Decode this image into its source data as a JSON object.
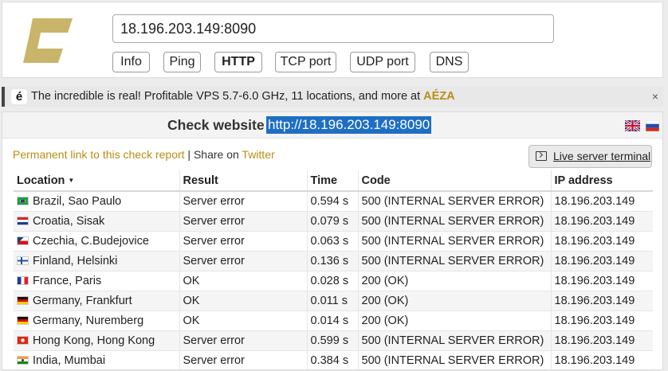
{
  "header": {
    "url_value": "18.196.203.149:8090",
    "tabs": [
      "Info",
      "Ping",
      "HTTP",
      "TCP port",
      "UDP port",
      "DNS"
    ],
    "active_tab": "HTTP"
  },
  "ad": {
    "badge": "é",
    "text": "The incredible is real! Profitable VPS 5.7-6.0 GHz, 11 locations, and more at ",
    "brand": "AÉZA",
    "close": "×"
  },
  "panel": {
    "title": "Check website",
    "url": "http://18.196.203.149:8090",
    "permalink": "Permanent link to this check report",
    "separator": " | Share on ",
    "twitter": "Twitter",
    "terminal_button": "Live server terminal"
  },
  "table": {
    "headers": [
      "Location",
      "Result",
      "Time",
      "Code",
      "IP address"
    ],
    "sort_indicator": "▼",
    "rows": [
      {
        "flag": "brazil",
        "location": "Brazil, Sao Paulo",
        "result": "Server error",
        "time": "0.594 s",
        "code": "500 (INTERNAL SERVER ERROR)",
        "ip": "18.196.203.149",
        "error": true
      },
      {
        "flag": "croatia",
        "location": "Croatia, Sisak",
        "result": "Server error",
        "time": "0.079 s",
        "code": "500 (INTERNAL SERVER ERROR)",
        "ip": "18.196.203.149",
        "error": true
      },
      {
        "flag": "czechia",
        "location": "Czechia, C.Budejovice",
        "result": "Server error",
        "time": "0.063 s",
        "code": "500 (INTERNAL SERVER ERROR)",
        "ip": "18.196.203.149",
        "error": true
      },
      {
        "flag": "finland",
        "location": "Finland, Helsinki",
        "result": "Server error",
        "time": "0.136 s",
        "code": "500 (INTERNAL SERVER ERROR)",
        "ip": "18.196.203.149",
        "error": true
      },
      {
        "flag": "france",
        "location": "France, Paris",
        "result": "OK",
        "time": "0.028 s",
        "code": "200 (OK)",
        "ip": "18.196.203.149",
        "error": false
      },
      {
        "flag": "germany",
        "location": "Germany, Frankfurt",
        "result": "OK",
        "time": "0.011 s",
        "code": "200 (OK)",
        "ip": "18.196.203.149",
        "error": false
      },
      {
        "flag": "germany",
        "location": "Germany, Nuremberg",
        "result": "OK",
        "time": "0.014 s",
        "code": "200 (OK)",
        "ip": "18.196.203.149",
        "error": false
      },
      {
        "flag": "hongkong",
        "location": "Hong Kong, Hong Kong",
        "result": "Server error",
        "time": "0.599 s",
        "code": "500 (INTERNAL SERVER ERROR)",
        "ip": "18.196.203.149",
        "error": true
      },
      {
        "flag": "india",
        "location": "India, Mumbai",
        "result": "Server error",
        "time": "0.384 s",
        "code": "500 (INTERNAL SERVER ERROR)",
        "ip": "18.196.203.149",
        "error": true
      }
    ]
  },
  "colors": {
    "brand_gold": "#c9b56a",
    "error_red": "#d32222",
    "link_gold": "#b88f12",
    "highlight_blue": "#1e6fc4"
  }
}
